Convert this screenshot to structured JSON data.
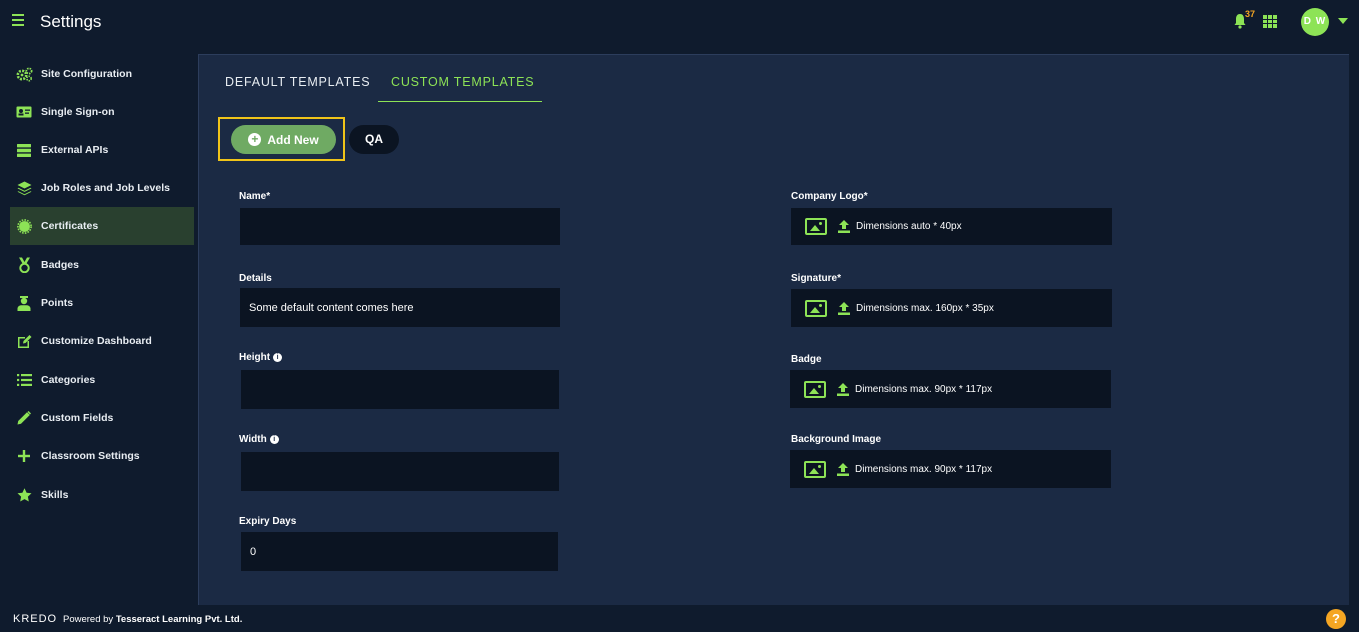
{
  "header": {
    "title": "Settings",
    "notification_count": "37",
    "avatar_initials": "D W"
  },
  "sidebar": {
    "items": [
      {
        "label": "Site Configuration",
        "icon": "cogs-icon"
      },
      {
        "label": "Single Sign-on",
        "icon": "id-card-icon"
      },
      {
        "label": "External APIs",
        "icon": "server-icon"
      },
      {
        "label": "Job Roles and Job Levels",
        "icon": "layers-icon"
      },
      {
        "label": "Certificates",
        "icon": "certificate-icon",
        "active": true
      },
      {
        "label": "Badges",
        "icon": "medal-icon"
      },
      {
        "label": "Points",
        "icon": "user-points-icon"
      },
      {
        "label": "Customize Dashboard",
        "icon": "edit-icon"
      },
      {
        "label": "Categories",
        "icon": "list-icon"
      },
      {
        "label": "Custom Fields",
        "icon": "pencil-icon"
      },
      {
        "label": "Classroom Settings",
        "icon": "plus-icon"
      },
      {
        "label": "Skills",
        "icon": "star-icon"
      }
    ]
  },
  "tabs": {
    "default": "DEFAULT TEMPLATES",
    "custom": "CUSTOM TEMPLATES"
  },
  "actions": {
    "add_new": "Add New",
    "chip": "QA"
  },
  "form": {
    "name_label": "Name*",
    "name_value": "",
    "details_label": "Details",
    "details_value": "Some default content comes here",
    "height_label": "Height",
    "height_value": "",
    "width_label": "Width",
    "width_value": "",
    "expiry_label": "Expiry Days",
    "expiry_value": "0",
    "company_logo_label": "Company Logo*",
    "company_logo_hint": "Dimensions auto * 40px",
    "signature_label": "Signature*",
    "signature_hint": "Dimensions max. 160px * 35px",
    "badge_label": "Badge",
    "badge_hint": "Dimensions max. 90px * 117px",
    "background_label": "Background Image",
    "background_hint": "Dimensions max. 90px * 117px"
  },
  "footer": {
    "logo": "KREDO",
    "powered_by": "Powered by",
    "company": "Tesseract Learning Pvt. Ltd."
  },
  "colors": {
    "accent": "#8de356",
    "background": "#0f1b2d",
    "panel": "#1b2a44",
    "field": "#0b1422",
    "highlight": "#f0c419",
    "help": "#f5a623"
  }
}
